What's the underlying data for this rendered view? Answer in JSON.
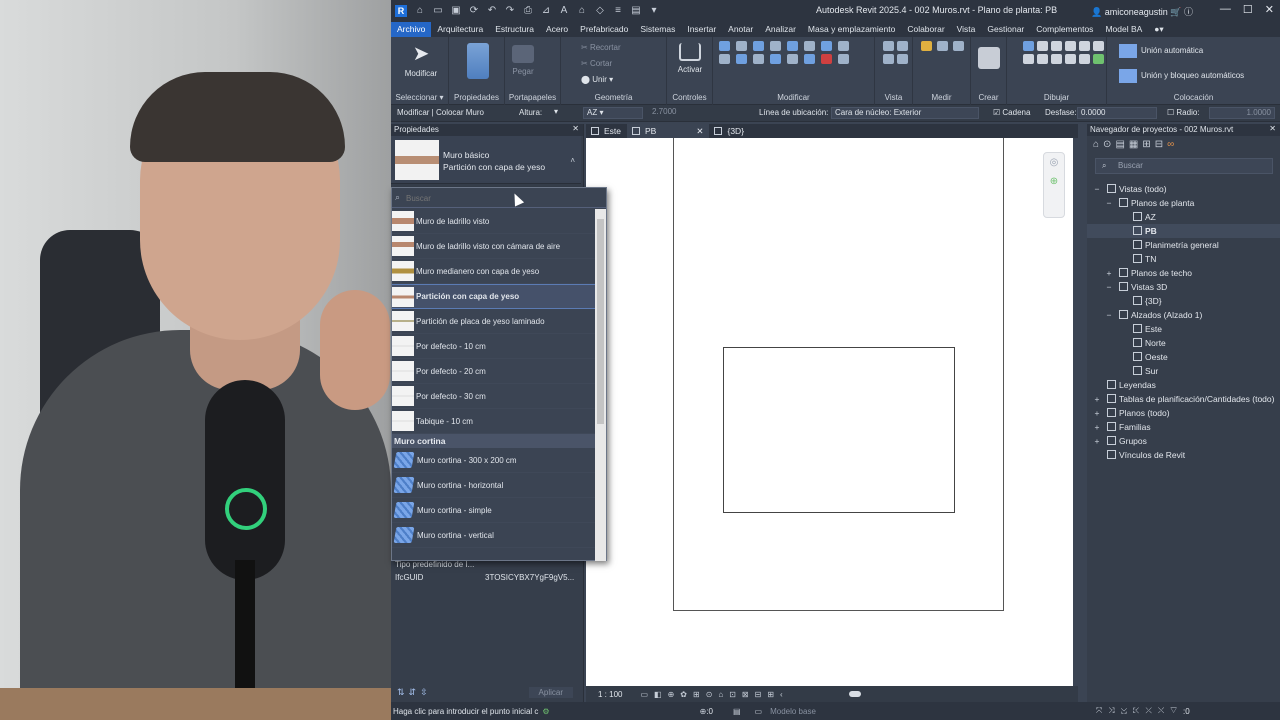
{
  "window": {
    "title": "Autodesk Revit 2025.4 - 002 Muros.rvt - Plano de planta: PB",
    "user": "amiconeagustin"
  },
  "ribbon_tabs": [
    "Archivo",
    "Arquitectura",
    "Estructura",
    "Acero",
    "Prefabricado",
    "Sistemas",
    "Insertar",
    "Anotar",
    "Analizar",
    "Masa y emplazamiento",
    "Colaborar",
    "Vista",
    "Gestionar",
    "Complementos",
    "Model BA"
  ],
  "ribbon": {
    "modificar": "Modificar",
    "seleccionar": "Seleccionar",
    "propiedades": "Propiedades",
    "portapapeles": "Portapapeles",
    "pegar": "Pegar",
    "recortar": "Recortar",
    "cortar": "Cortar",
    "unir": "Unir",
    "geometria": "Geometría",
    "activar": "Activar",
    "controles": "Controles",
    "modificar_grp": "Modificar",
    "vista": "Vista",
    "medir": "Medir",
    "crear": "Crear",
    "dibujar": "Dibujar",
    "union_auto": "Unión automática",
    "union_bloqueo": "Unión y bloqueo automáticos",
    "colocacion": "Colocación"
  },
  "options_bar": {
    "context": "Modificar | Colocar Muro",
    "altura_label": "Altura:",
    "altura_value": "AZ",
    "altura_num": "2.7000",
    "linea_label": "Línea de ubicación:",
    "linea_value": "Cara de núcleo: Exterior",
    "cadena": "Cadena",
    "desfase_label": "Desfase:",
    "desfase_value": "0.0000",
    "radio_label": "Radio:",
    "radio_value": "1.0000"
  },
  "properties": {
    "title": "Propiedades",
    "family": "Muro básico",
    "type": "Partición con capa de yeso",
    "rows": [
      {
        "k": "Tipo predefinido de I...",
        "v": ""
      },
      {
        "k": "IfcGUID",
        "v": "3TOSICYBX7YgF9gV5..."
      }
    ],
    "apply": "Aplicar"
  },
  "dropdown": {
    "search_placeholder": "Buscar",
    "items": [
      "Muro de ladrillo visto",
      "Muro de ladrillo visto con cámara de aire",
      "Muro medianero con capa de yeso",
      "Partición con capa de yeso",
      "Partición de placa de yeso laminado",
      "Por defecto - 10 cm",
      "Por defecto - 20 cm",
      "Por defecto - 30 cm",
      "Tabique - 10 cm"
    ],
    "group": "Muro cortina",
    "curtain_items": [
      "Muro cortina - 300 x 200 cm",
      "Muro cortina - horizontal",
      "Muro cortina - simple",
      "Muro cortina - vertical"
    ]
  },
  "view_tabs": [
    "Este",
    "PB",
    "{3D}"
  ],
  "view_bar": {
    "scale": "1 : 100"
  },
  "browser": {
    "title": "Navegador de proyectos - 002 Muros.rvt",
    "search": "Buscar",
    "tree": [
      {
        "t": "Vistas (todo)",
        "l": 0,
        "tg": "−"
      },
      {
        "t": "Planos de planta",
        "l": 1,
        "tg": "−"
      },
      {
        "t": "AZ",
        "l": 2,
        "tg": ""
      },
      {
        "t": "PB",
        "l": 2,
        "tg": "",
        "b": true
      },
      {
        "t": "Planimetría general",
        "l": 2,
        "tg": ""
      },
      {
        "t": "TN",
        "l": 2,
        "tg": ""
      },
      {
        "t": "Planos de techo",
        "l": 1,
        "tg": "+"
      },
      {
        "t": "Vistas 3D",
        "l": 1,
        "tg": "−"
      },
      {
        "t": "{3D}",
        "l": 2,
        "tg": ""
      },
      {
        "t": "Alzados (Alzado 1)",
        "l": 1,
        "tg": "−"
      },
      {
        "t": "Este",
        "l": 2,
        "tg": ""
      },
      {
        "t": "Norte",
        "l": 2,
        "tg": ""
      },
      {
        "t": "Oeste",
        "l": 2,
        "tg": ""
      },
      {
        "t": "Sur",
        "l": 2,
        "tg": ""
      },
      {
        "t": "Leyendas",
        "l": 0,
        "tg": ""
      },
      {
        "t": "Tablas de planificación/Cantidades (todo)",
        "l": 0,
        "tg": "+"
      },
      {
        "t": "Planos (todo)",
        "l": 0,
        "tg": "+"
      },
      {
        "t": "Familias",
        "l": 0,
        "tg": "+"
      },
      {
        "t": "Grupos",
        "l": 0,
        "tg": "+"
      },
      {
        "t": "Vínculos de Revit",
        "l": 0,
        "tg": ""
      }
    ]
  },
  "status": {
    "text": "Haga clic para introducir el punto inicial c",
    "zero": ":0",
    "model": "Modelo base",
    "filter": ":0"
  }
}
